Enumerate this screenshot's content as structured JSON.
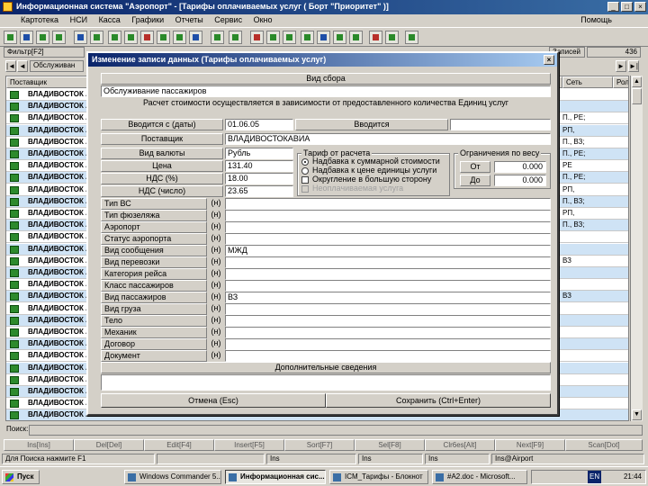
{
  "app": {
    "title": "Информационная система \"Аэропорт\" - [Тарифы оплачиваемых услуг ( Борт \"Приоритет\" )]",
    "menu": [
      "Картотека",
      "НСИ",
      "Касса",
      "Графики",
      "Отчеты",
      "Сервис",
      "Окно"
    ],
    "menu_right": "Помощь"
  },
  "filter": {
    "label": "Фильтр[F2]",
    "right_label": "Записей",
    "count": "436"
  },
  "nav": {
    "first": "|◄",
    "prev": "◄",
    "next": "►",
    "last": "►|",
    "current": "Обслуживан"
  },
  "grid": {
    "header_supplier": "Поставщик",
    "header_right1": "Кол",
    "header_right2": "Сеть",
    "header_right3": "Ролс",
    "rows": [
      {
        "supplier": "ВЛАДИВОСТОК А",
        "right": ""
      },
      {
        "supplier": "ВЛАДИВОСТОК А",
        "right": ""
      },
      {
        "supplier": "ВЛАДИВОСТОК А",
        "right": "П., РЕ;"
      },
      {
        "supplier": "ВЛАДИВОСТОК А",
        "right": "РП,"
      },
      {
        "supplier": "ВЛАДИВОСТОК А",
        "right": "П., ВЗ;"
      },
      {
        "supplier": "ВЛАДИВОСТОК А",
        "right": "П., РЕ;"
      },
      {
        "supplier": "ВЛАДИВОСТОК А",
        "right": "РЕ"
      },
      {
        "supplier": "ВЛАДИВОСТОК А",
        "right": "П., РЕ;"
      },
      {
        "supplier": "ВЛАДИВОСТОК А",
        "right": "РП,"
      },
      {
        "supplier": "ВЛАДИВОСТОК А",
        "right": "П., ВЗ;"
      },
      {
        "supplier": "ВЛАДИВОСТОК А",
        "right": "РП,"
      },
      {
        "supplier": "ВЛАДИВОСТОК А",
        "right": "П., ВЗ;"
      },
      {
        "supplier": "ВЛАДИВОСТОК А",
        "right": ""
      },
      {
        "supplier": "ВЛАДИВОСТОК А",
        "right": ""
      },
      {
        "supplier": "ВЛАДИВОСТОК А",
        "right": "ВЗ"
      },
      {
        "supplier": "ВЛАДИВОСТОК А",
        "right": ""
      },
      {
        "supplier": "ВЛАДИВОСТОК А",
        "right": ""
      },
      {
        "supplier": "ВЛАДИВОСТОК А",
        "right": "ВЗ"
      },
      {
        "supplier": "ВЛАДИВОСТОК А",
        "right": ""
      },
      {
        "supplier": "ВЛАДИВОСТОК А",
        "right": ""
      },
      {
        "supplier": "ВЛАДИВОСТОК А",
        "right": ""
      },
      {
        "supplier": "ВЛАДИВОСТОК А",
        "right": ""
      },
      {
        "supplier": "ВЛАДИВОСТОК А",
        "right": ""
      },
      {
        "supplier": "ВЛАДИВОСТОК А",
        "right": ""
      },
      {
        "supplier": "ВЛАДИВОСТОК А",
        "right": ""
      },
      {
        "supplier": "ВЛАДИВОСТОК А",
        "right": ""
      },
      {
        "supplier": "ВЛАДИВОСТОК А",
        "right": ""
      },
      {
        "supplier": "ВЛАДИВОСТОК А",
        "right": ""
      }
    ]
  },
  "dialog": {
    "title": "Изменение записи данных (Тарифы оплачиваемых услуг)",
    "service_header": "Вид сбора",
    "service_value": "Обслуживание пассажиров",
    "calc_note": "Расчет стоимости осуществляется в зависимости от предоставленного количества Единиц услуг",
    "date_label": "Вводится с (даты)",
    "date_value": "01.06.05",
    "vydnot_label": "Вводится",
    "vydnot_value": "",
    "supplier_label": "Поставщик",
    "supplier_value": "ВЛАДИВОСТОКАВИА",
    "currency_label": "Вид валюты",
    "currency_value": "Рубль",
    "price_label": "Цена",
    "price_value": "131.40",
    "vat_pct_label": "НДС (%)",
    "vat_pct_value": "18.00",
    "vat_sum_label": "НДС (число)",
    "vat_sum_value": "23.65",
    "rounding_group": "Тариф от расчета",
    "rounding_opts": [
      {
        "label": "Надбавка к суммарной стоимости",
        "checked": true,
        "kind": "radio"
      },
      {
        "label": "Надбавка к цене единицы услуги",
        "checked": false,
        "kind": "radio"
      },
      {
        "label": "Округление в большую сторону",
        "checked": false,
        "kind": "check"
      },
      {
        "label": "Неоплачиваемая услуга",
        "checked": false,
        "kind": "check",
        "disabled": true
      }
    ],
    "weight_group": "Ограничения по весу",
    "weight_from_label": "От",
    "weight_from_value": "0.000",
    "weight_to_label": "До",
    "weight_to_value": "0.000",
    "fields": [
      {
        "label": "Тип ВС",
        "mark": "(н)",
        "value": ""
      },
      {
        "label": "Тип фюзеляжа",
        "mark": "(н)",
        "value": ""
      },
      {
        "label": "Аэропорт",
        "mark": "(н)",
        "value": ""
      },
      {
        "label": "Статус аэропорта",
        "mark": "(н)",
        "value": ""
      },
      {
        "label": "Вид сообщения",
        "mark": "(н)",
        "value": "МЖД"
      },
      {
        "label": "Вид перевозки",
        "mark": "(н)",
        "value": ""
      },
      {
        "label": "Категория рейса",
        "mark": "(н)",
        "value": ""
      },
      {
        "label": "Класс пассажиров",
        "mark": "(н)",
        "value": ""
      },
      {
        "label": "Вид пассажиров",
        "mark": "(н)",
        "value": "ВЗ"
      },
      {
        "label": "Вид груза",
        "mark": "(н)",
        "value": ""
      },
      {
        "label": "Тело",
        "mark": "(н)",
        "value": ""
      },
      {
        "label": "Механик",
        "mark": "(н)",
        "value": ""
      },
      {
        "label": "Договор",
        "mark": "(н)",
        "value": ""
      },
      {
        "label": "Документ",
        "mark": "(н)",
        "value": ""
      }
    ],
    "extra_header": "Дополнительные сведения",
    "extra_value": "",
    "cancel_label": "Отмена (Esc)",
    "save_label": "Сохранить (Ctrl+Enter)"
  },
  "search": {
    "label": "Поиск:",
    "value": ""
  },
  "function_keys": [
    "Ins[Ins]",
    "Del[Del]",
    "Edit[F4]",
    "Insert[F5]",
    "Sort[F7]",
    "Sel[F8]",
    "Clr6es[Alt]",
    "Next[F9]",
    "Scan[Dot]"
  ],
  "statusbar": {
    "hint": "Для Поиска нажмите F1",
    "s2": "",
    "s3": "Ins",
    "s4": "Ins",
    "s5": "Ins",
    "s6": "Ins@Airport"
  },
  "taskbar": {
    "start": "Пуск",
    "items": [
      "Windows Commander 5...",
      "Информационная сис...",
      "ICM_Тарифы - Блокнот",
      "#A2.doc - Microsoft..."
    ],
    "tray_lang": "EN",
    "clock": "21:44"
  }
}
